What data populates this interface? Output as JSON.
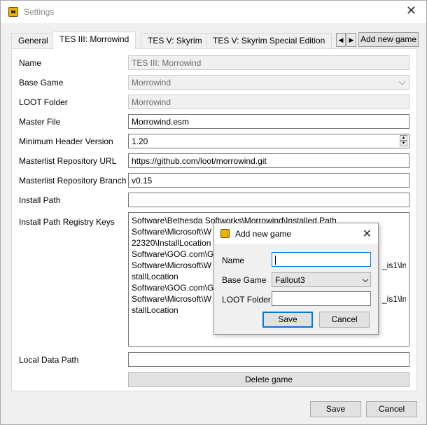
{
  "window": {
    "title": "Settings"
  },
  "tabs": [
    "General",
    "TES III: Morrowind",
    "TES V: Skyrim",
    "TES V: Skyrim Special Edition"
  ],
  "tab_scroll": {
    "left": "◀",
    "right": "▶"
  },
  "add_game_label": "Add new game",
  "form": {
    "name_label": "Name",
    "name_value": "TES III: Morrowind",
    "base_game_label": "Base Game",
    "base_game_value": "Morrowind",
    "loot_folder_label": "LOOT Folder",
    "loot_folder_value": "Morrowind",
    "master_file_label": "Master File",
    "master_file_value": "Morrowind.esm",
    "min_header_label": "Minimum Header Version",
    "min_header_value": "1.20",
    "masterlist_url_label": "Masterlist Repository URL",
    "masterlist_url_value": "https://github.com/loot/morrowind.git",
    "masterlist_branch_label": "Masterlist Repository Branch",
    "masterlist_branch_value": "v0.15",
    "install_path_label": "Install Path",
    "install_path_value": "",
    "registry_keys_label": "Install Path Registry Keys",
    "registry_keys_lines": [
      "Software\\Bethesda Softworks\\Morrowind\\Installed Path",
      "Software\\Microsoft\\W",
      "22320\\InstallLocation",
      "Software\\GOG.com\\Ga",
      "Software\\Microsoft\\W",
      "stallLocation",
      "Software\\GOG.com\\Ga",
      "Software\\Microsoft\\W",
      "stallLocation"
    ],
    "registry_keys_tail": [
      "_is1\\In",
      "_is1\\In"
    ],
    "local_data_label": "Local Data Path",
    "local_data_value": "",
    "delete_label": "Delete game"
  },
  "footer": {
    "save_label": "Save",
    "cancel_label": "Cancel"
  },
  "dialog": {
    "title": "Add new game",
    "name_label": "Name",
    "name_value": "",
    "base_game_label": "Base Game",
    "base_game_value": "Fallout3",
    "loot_folder_label": "LOOT Folder",
    "loot_folder_value": "",
    "save_label": "Save",
    "cancel_label": "Cancel"
  },
  "colors": {
    "accent": "#0078d7",
    "icon": "#e8b300"
  }
}
